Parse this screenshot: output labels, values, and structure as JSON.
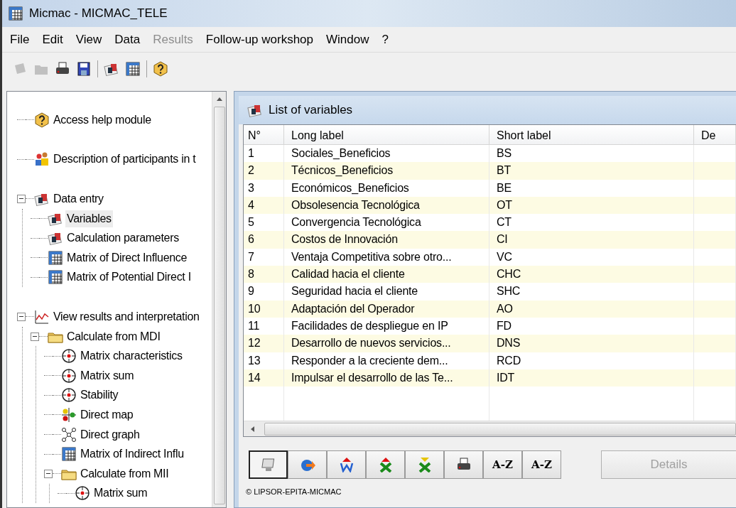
{
  "window": {
    "title": "Micmac - MICMAC_TELE"
  },
  "menu": [
    {
      "label": "File",
      "disabled": false
    },
    {
      "label": "Edit",
      "disabled": false
    },
    {
      "label": "View",
      "disabled": false
    },
    {
      "label": "Data",
      "disabled": false
    },
    {
      "label": "Results",
      "disabled": true
    },
    {
      "label": "Follow-up workshop",
      "disabled": false
    },
    {
      "label": "Window",
      "disabled": false
    },
    {
      "label": "?",
      "disabled": false
    }
  ],
  "toolbar": [
    {
      "kind": "new",
      "disabled": true
    },
    {
      "kind": "open",
      "disabled": true
    },
    {
      "kind": "print",
      "disabled": false
    },
    {
      "kind": "save",
      "disabled": false
    },
    {
      "kind": "sep"
    },
    {
      "kind": "data",
      "disabled": false
    },
    {
      "kind": "grid",
      "disabled": false
    },
    {
      "kind": "sep"
    },
    {
      "kind": "help",
      "disabled": false
    }
  ],
  "tree": [
    {
      "label": "Access help module",
      "kind": "help",
      "selected": false
    },
    {
      "label": "Description of participants in t",
      "kind": "people",
      "selected": false
    },
    {
      "label": "Data entry",
      "kind": "data",
      "selected": false,
      "expanded": true,
      "children": [
        {
          "label": "Variables",
          "kind": "data",
          "selected": true
        },
        {
          "label": "Calculation parameters",
          "kind": "data",
          "selected": false
        },
        {
          "label": "Matrix of Direct Influence",
          "kind": "grid",
          "selected": false
        },
        {
          "label": "Matrix of Potential Direct I",
          "kind": "grid",
          "selected": false
        }
      ]
    },
    {
      "label": "View results and interpretation",
      "kind": "chart",
      "selected": false,
      "expanded": true,
      "children": [
        {
          "label": "Calculate from MDI",
          "kind": "folder",
          "selected": false,
          "expanded": true,
          "children": [
            {
              "label": "Matrix characteristics",
              "kind": "target",
              "selected": false
            },
            {
              "label": "Matrix sum",
              "kind": "target",
              "selected": false
            },
            {
              "label": "Stability",
              "kind": "target",
              "selected": false
            },
            {
              "label": "Direct map",
              "kind": "map",
              "selected": false
            },
            {
              "label": "Direct graph",
              "kind": "graph",
              "selected": false
            },
            {
              "label": "Matrix of Indirect Influ",
              "kind": "grid",
              "selected": false
            },
            {
              "label": "Calculate from MII",
              "kind": "folder",
              "selected": false,
              "expanded": true,
              "children": [
                {
                  "label": "Matrix sum",
                  "kind": "target",
                  "selected": false
                }
              ]
            }
          ]
        }
      ]
    }
  ],
  "child_window": {
    "title": "List of variables",
    "table": {
      "columns": [
        "N°",
        "Long label",
        "Short label",
        "De"
      ],
      "rows": [
        [
          "1",
          "Sociales_Beneficios",
          "BS"
        ],
        [
          "2",
          "Técnicos_Beneficios",
          "BT"
        ],
        [
          "3",
          "Económicos_Beneficios",
          "BE"
        ],
        [
          "4",
          "Obsolesencia Tecnológica",
          "OT"
        ],
        [
          "5",
          "Convergencia Tecnológica",
          "CT"
        ],
        [
          "6",
          "Costos de Innovación",
          "CI"
        ],
        [
          "7",
          "Ventaja Competitiva sobre otro...",
          "VC"
        ],
        [
          "8",
          "Calidad hacia el cliente",
          "CHC"
        ],
        [
          "9",
          "Seguridad hacia el cliente",
          "SHC"
        ],
        [
          "10",
          "Adaptación del Operador",
          "AO"
        ],
        [
          "11",
          "Facilidades de despliegue en IP",
          "FD"
        ],
        [
          "12",
          "Desarrollo de nuevos servicios...",
          "DNS"
        ],
        [
          "13",
          "Responder a la creciente dem...",
          "RCD"
        ],
        [
          "14",
          "Impulsar el desarrollo de las Te...",
          "IDT"
        ]
      ]
    },
    "buttons": [
      {
        "kind": "monitor",
        "selected": true
      },
      {
        "kind": "export",
        "selected": false
      },
      {
        "kind": "word",
        "selected": false
      },
      {
        "kind": "excel-up",
        "selected": false
      },
      {
        "kind": "excel-down",
        "selected": false
      },
      {
        "kind": "print",
        "selected": false
      },
      {
        "kind": "sort",
        "label": "A-Z",
        "selected": false
      },
      {
        "kind": "sort",
        "label": "A-Z",
        "selected": false
      }
    ],
    "details_button": {
      "label": "Details",
      "disabled": true
    },
    "copyright": "© LIPSOR-EPITA-MICMAC"
  }
}
